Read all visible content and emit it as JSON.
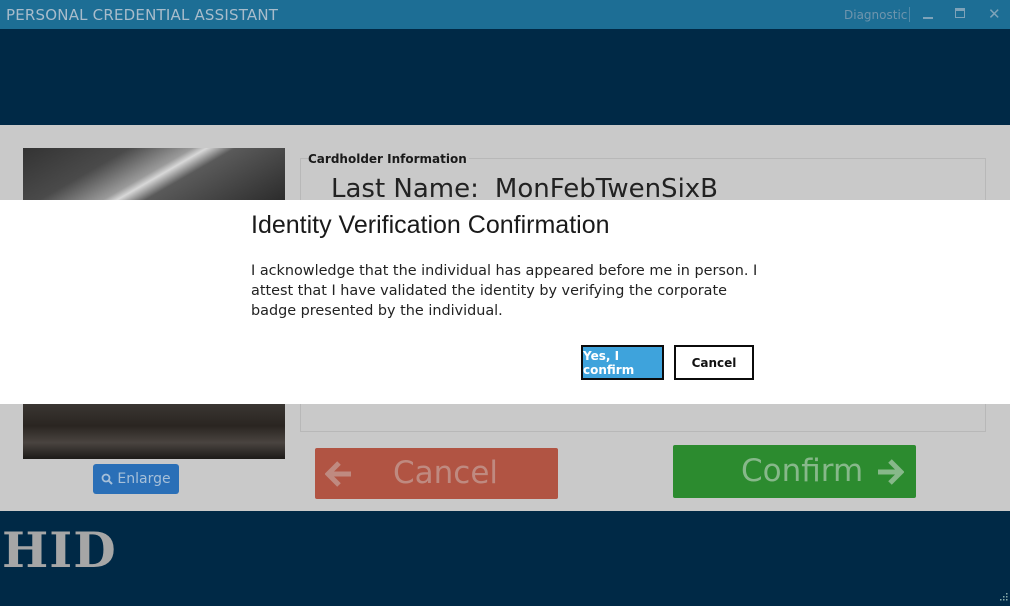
{
  "window": {
    "title": "PERSONAL CREDENTIAL ASSISTANT",
    "diagnostic_label": "Diagnostic",
    "close_glyph": "✕"
  },
  "photo": {
    "enlarge_label": "Enlarge"
  },
  "cardholder": {
    "section_title": "Cardholder Information",
    "last_name_label": "Last Name:",
    "last_name_value": "MonFebTwenSixB"
  },
  "actions": {
    "cancel_label": "Cancel",
    "confirm_label": "Confirm"
  },
  "footer": {
    "logo_text": "HID"
  },
  "dialog": {
    "title": "Identity Verification Confirmation",
    "message": "I acknowledge that the individual has appeared before me in person. I attest that I have validated the identity by verifying the corporate badge presented by the individual.",
    "confirm_label": "Yes, I confirm",
    "cancel_label": "Cancel"
  },
  "colors": {
    "titlebar": "#1d6e95",
    "header_band": "#002946",
    "confirm_button": "#2c8b2f",
    "cancel_button": "#b15443",
    "dialog_primary": "#3ea3dc"
  },
  "icons": {
    "enlarge": "magnifier-icon",
    "cancel": "arrow-left-icon",
    "confirm": "arrow-right-icon",
    "minimize": "minimize-icon",
    "maximize": "maximize-icon",
    "close": "close-icon",
    "resize": "resize-grip-icon"
  }
}
